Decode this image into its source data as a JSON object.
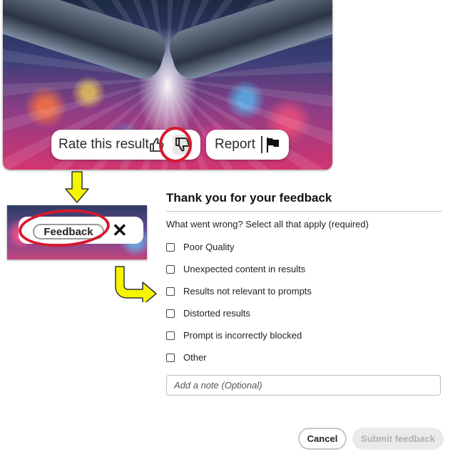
{
  "hero": {
    "rate_label": "Rate this result",
    "report_label": "Report",
    "icons": [
      "thumbs-up-icon",
      "thumbs-down-icon",
      "flag-icon"
    ]
  },
  "strip": {
    "feedback_label": "Feedback",
    "close_glyph": "✕"
  },
  "panel": {
    "title": "Thank you for your feedback",
    "question": "What went wrong? Select all that apply (required)",
    "options": [
      "Poor Quality",
      "Unexpected content in results",
      "Results not relevant to prompts",
      "Distorted results",
      "Prompt is incorrectly blocked",
      "Other"
    ],
    "note_placeholder": "Add a note (Optional)",
    "cancel_label": "Cancel",
    "submit_label": "Submit feedback"
  },
  "colors": {
    "highlight_circle": "#d7192c",
    "arrow_fill": "#f5f500"
  }
}
